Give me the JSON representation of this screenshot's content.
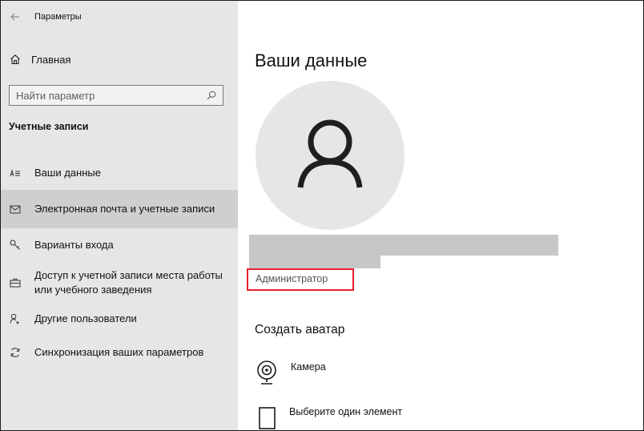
{
  "window": {
    "title": "Параметры",
    "back_icon": "arrow-left-icon"
  },
  "sidebar": {
    "home": {
      "label": "Главная",
      "icon": "home-icon"
    },
    "search": {
      "placeholder": "Найти параметр",
      "icon": "search-icon"
    },
    "section_title": "Учетные записи",
    "items": [
      {
        "label": "Ваши данные",
        "icon": "person-card-icon",
        "selected": false
      },
      {
        "label": "Электронная почта и учетные записи",
        "icon": "mail-icon",
        "selected": true
      },
      {
        "label": "Варианты входа",
        "icon": "key-icon",
        "selected": false
      },
      {
        "label_line1": "Доступ к учетной записи места работы",
        "label_line2": "или учебного заведения",
        "icon": "briefcase-icon",
        "selected": false
      },
      {
        "label": "Другие пользователи",
        "icon": "add-person-icon",
        "selected": false
      },
      {
        "label": "Синхронизация ваших параметров",
        "icon": "sync-icon",
        "selected": false
      }
    ]
  },
  "main": {
    "title": "Ваши данные",
    "avatar_icon": "user-silhouette-icon",
    "role": "Администратор",
    "role_highlight_color": "#e8202c",
    "create_avatar_title": "Создать аватар",
    "options": [
      {
        "label": "Камера",
        "icon": "webcam-icon"
      },
      {
        "label": "Выберите один элемент",
        "icon": "document-icon"
      }
    ]
  },
  "colors": {
    "sidebar_bg": "#e6e6e6",
    "selected_bg": "#cfcfcf",
    "redaction": "#c7c7c7"
  }
}
